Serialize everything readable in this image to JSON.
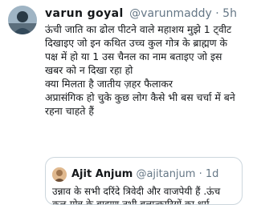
{
  "tweet": {
    "author_name": "varun goyal",
    "author_handle": "@varunmaddy",
    "separator": "·",
    "time": "5h",
    "body_lines": [
      "ऊंची जाति का ढोल पीटने वाले महाशय मुझे 1 ट्वीट",
      "दिखाइए जो इन कथित उच्च कुल गोत्र के ब्राह्मण के",
      "पक्ष में हो या 1 उस चैनल का नाम बताइए जो इस",
      "खबर को न दिखा रहा हो",
      "क्या मिलता है जातीय ज़हर फैलाकर",
      "अप्रासंगिक हो चुके कुछ लोग कैसे भी बस चर्चा में बने",
      "रहना चाहते हैं"
    ]
  },
  "quoted_tweet": {
    "author_name": "Ajit Anjum",
    "author_handle": "@ajitanjum",
    "separator": "·",
    "time": "1d",
    "body_lines": [
      "उन्नाव के सभी दरिंदे त्रिवेदी और वाजपेयी हैं .ऊंच",
      "कुल-गोत्र के ब्राह्मण.तभी बलात्कारियों का धर्म"
    ]
  }
}
